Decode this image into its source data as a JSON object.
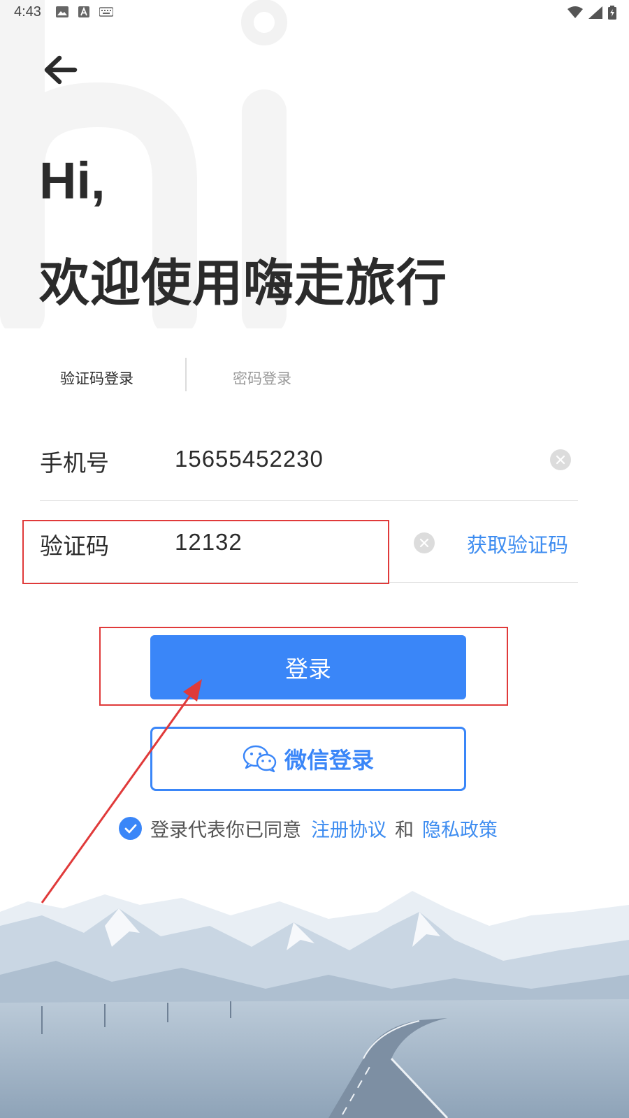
{
  "status_bar": {
    "time": "4:43",
    "left_icons": [
      "image-icon",
      "font-icon",
      "keyboard-icon"
    ],
    "right_icons": [
      "wifi-icon",
      "signal-icon",
      "battery-icon"
    ]
  },
  "greeting": {
    "line1": "Hi,",
    "line2": "欢迎使用嗨走旅行"
  },
  "tabs": [
    {
      "label": "验证码登录",
      "active": true
    },
    {
      "label": "密码登录",
      "active": false
    }
  ],
  "form": {
    "phone_label": "手机号",
    "phone_value": "15655452230",
    "code_label": "验证码",
    "code_value": "12132",
    "get_code_label": "获取验证码"
  },
  "buttons": {
    "login_label": "登录",
    "wechat_label": "微信登录"
  },
  "agreement": {
    "checked": true,
    "prefix": "登录代表你已同意",
    "terms_link": "注册协议",
    "conjunction": "和",
    "privacy_link": "隐私政策"
  },
  "colors": {
    "accent": "#3a86f8",
    "link": "#3d8cf0",
    "annotation": "#e03a3a",
    "text": "#2b2b2b"
  }
}
